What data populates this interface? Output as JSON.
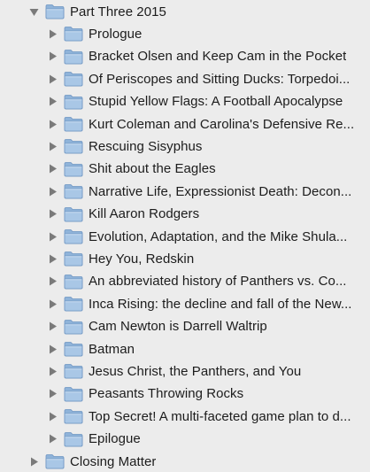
{
  "binder": {
    "groups": [
      {
        "title": "Part Three 2015",
        "expanded": true,
        "children": [
          "Prologue",
          "Bracket Olsen and Keep Cam in the Pocket",
          "Of Periscopes and Sitting Ducks: Torpedoi...",
          "Stupid Yellow Flags: A Football Apocalypse",
          "Kurt Coleman and Carolina's Defensive Re...",
          "Rescuing Sisyphus",
          "Shit about the Eagles",
          "Narrative Life, Expressionist Death: Decon...",
          "Kill Aaron Rodgers",
          "Evolution, Adaptation, and the Mike Shula...",
          "Hey You, Redskin",
          "An abbreviated history of Panthers vs. Co...",
          "Inca Rising: the decline and fall of the New...",
          "Cam Newton is Darrell Waltrip",
          "Batman",
          "Jesus Christ, the Panthers, and You",
          "Peasants Throwing Rocks",
          "Top Secret! A multi-faceted game plan to d...",
          "Epilogue"
        ]
      },
      {
        "title": "Closing Matter",
        "expanded": false,
        "children": []
      }
    ]
  },
  "icons": {
    "disclosure_expanded": "triangle-down-icon",
    "disclosure_collapsed": "triangle-right-icon",
    "folder": "folder-icon"
  },
  "colors": {
    "background": "#ececec",
    "text": "#1c1c1c",
    "disclosure": "#7a7a7a",
    "folder_body": "#a9c7e6",
    "folder_tab": "#8fb3d9",
    "folder_outline": "#6e95c2"
  }
}
